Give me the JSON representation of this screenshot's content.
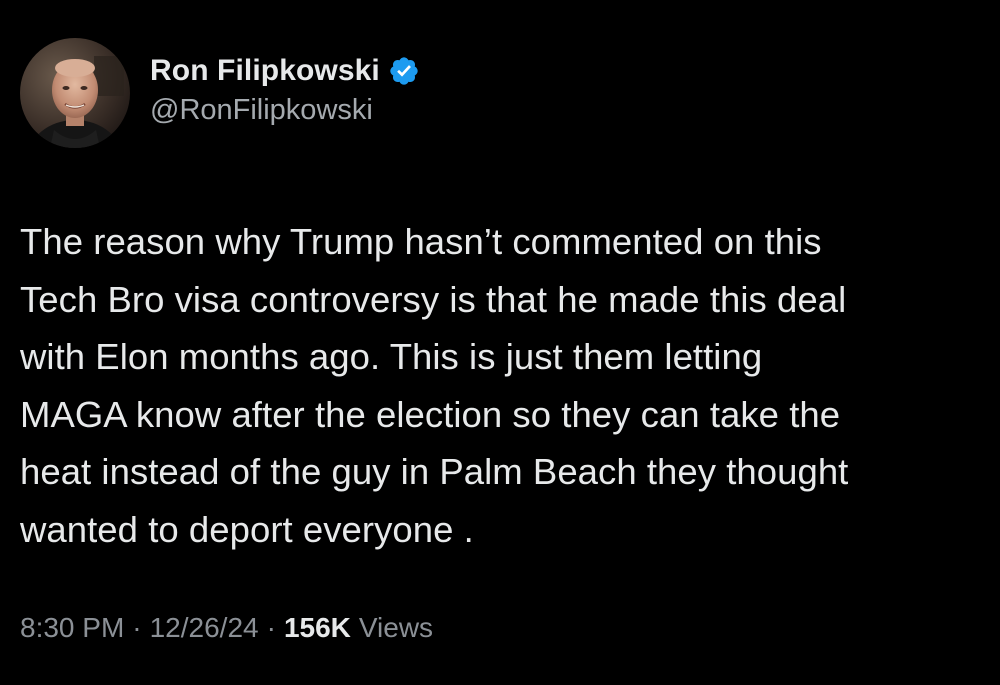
{
  "user": {
    "display_name": "Ron Filipkowski",
    "handle": "@RonFilipkowski",
    "verified_badge_color": "#1d9bf0"
  },
  "tweet": {
    "lines": [
      "The reason why Trump hasn’t commented on this",
      "Tech Bro visa controversy is that he made this deal",
      "with Elon months ago. This is just them letting",
      "MAGA know after the election so they can take the",
      "heat instead of the guy in Palm Beach they thought",
      "wanted to deport everyone ."
    ]
  },
  "meta": {
    "time": "8:30 PM",
    "separator": "·",
    "date": "12/26/24",
    "views_count": "156K",
    "views_label": "Views"
  }
}
